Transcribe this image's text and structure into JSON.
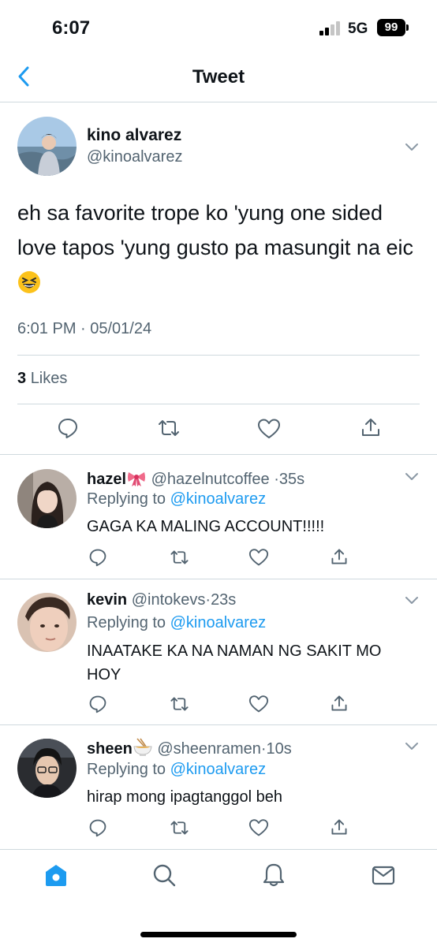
{
  "status_bar": {
    "time": "6:07",
    "network": "5G",
    "battery": "99"
  },
  "header": {
    "title": "Tweet",
    "back_icon": "chevron-left-icon"
  },
  "tweet": {
    "author_name": "kino alvarez",
    "author_handle": "@kinoalvarez",
    "text": "eh sa favorite trope ko 'yung one sided love tapos 'yung gusto pa masungit na eic",
    "emoji": "grinning-squinting-face-emoji",
    "timestamp": "6:01 PM · 05/01/24",
    "likes_count": "3",
    "likes_label": "Likes",
    "actions": [
      "reply-icon",
      "retweet-icon",
      "like-icon",
      "share-icon"
    ]
  },
  "replies": [
    {
      "name": "hazel",
      "name_emoji": "ribbon-emoji",
      "handle": "@hazelnutcoffee",
      "time": "35s",
      "replying_prefix": "Replying to",
      "replying_to": "@kinoalvarez",
      "text": "GAGA KA MALING ACCOUNT!!!!!"
    },
    {
      "name": "kevin",
      "handle": "@intokevs",
      "time": "23s",
      "replying_prefix": "Replying to",
      "replying_to": "@kinoalvarez",
      "text": "INAATAKE KA NA NAMAN NG SAKIT MO HOY"
    },
    {
      "name": "sheen",
      "name_emoji": "ramen-emoji",
      "handle": "@sheenramen",
      "time": "10s",
      "replying_prefix": "Replying to",
      "replying_to": "@kinoalvarez",
      "text": "hirap mong ipagtanggol beh"
    }
  ],
  "separator": "·",
  "tab_bar": [
    "home-icon",
    "search-icon",
    "notifications-icon",
    "messages-icon"
  ],
  "colors": {
    "accent": "#1d9bf0",
    "secondary_text": "#536471",
    "divider": "#cfd9de"
  }
}
